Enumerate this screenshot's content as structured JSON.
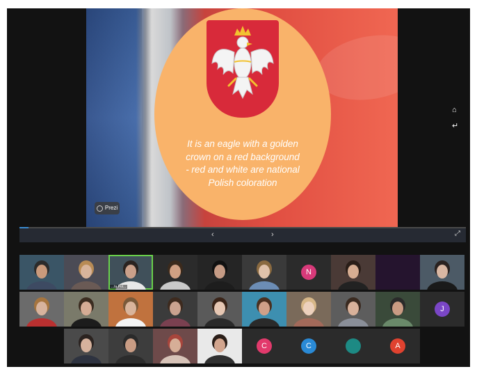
{
  "slide": {
    "text": "It is an eagle with a golden crown on a red background - red and white are national Polish coloration",
    "badge": "Prezi"
  },
  "presentation_controls": {
    "home_icon": "home-icon",
    "back_icon": "back-arrow-icon",
    "prev_label": "‹",
    "next_label": "›",
    "expand_icon": "expand-icon"
  },
  "progress": {
    "percent": 2
  },
  "gallery": {
    "tiles": [
      {
        "type": "video",
        "bg": "#3a5566",
        "skin": "#c99a7c",
        "hair": "#2b2b2b",
        "shirt": "#3d4a62"
      },
      {
        "type": "video",
        "bg": "#4b4b55",
        "skin": "#d8b49b",
        "hair": "#b88b55",
        "shirt": "#6a5a55"
      },
      {
        "type": "video",
        "bg": "#40505a",
        "skin": "#caa08a",
        "hair": "#2a2320",
        "shirt": "#e8e8e8",
        "name": "...ta Pol...",
        "active": true
      },
      {
        "type": "video",
        "bg": "#2b2b2b",
        "skin": "#d0a083",
        "hair": "#3b2a1c",
        "shirt": "#c9c9c9"
      },
      {
        "type": "video",
        "bg": "#252525",
        "skin": "#c59b85",
        "hair": "#111111",
        "shirt": "#1d1d1d"
      },
      {
        "type": "video",
        "bg": "#3a3a3a",
        "skin": "#e0c2aa",
        "hair": "#8a6a40",
        "shirt": "#6c8db5"
      },
      {
        "type": "avatar",
        "initial": "N",
        "color": "#d83a7a"
      },
      {
        "type": "video",
        "bg": "#4a3a36",
        "skin": "#d6ad92",
        "hair": "#2a1e18",
        "shirt": "#222222"
      },
      {
        "type": "empty",
        "bg": "#25142e"
      },
      {
        "type": "video",
        "bg": "#4c5a66",
        "skin": "#d9b7a3",
        "hair": "#2a2220",
        "shirt": "#1a1a1a"
      },
      {
        "type": "video",
        "bg": "#6b6b6b",
        "skin": "#d7b39d",
        "hair": "#a6753f",
        "shirt": "#b93030"
      },
      {
        "type": "video",
        "bg": "#7a7a6a",
        "skin": "#d5ac95",
        "hair": "#3b2c20",
        "shirt": "#1c1c1c"
      },
      {
        "type": "video",
        "bg": "#c0723e",
        "skin": "#d9b49b",
        "hair": "#7a5a3a",
        "shirt": "#f4f4f4"
      },
      {
        "type": "video",
        "bg": "#3b3b3b",
        "skin": "#caa28f",
        "hair": "#3d2a1e",
        "shirt": "#7a4050"
      },
      {
        "type": "video",
        "bg": "#5a5a5a",
        "skin": "#e6c7b3",
        "hair": "#3a2418",
        "shirt": "#2a2a2a"
      },
      {
        "type": "video",
        "bg": "#3d8fb0",
        "skin": "#d0a088",
        "hair": "#4a3020",
        "shirt": "#2a2a2a"
      },
      {
        "type": "video",
        "bg": "#7a6a5a",
        "skin": "#ecd0bd",
        "hair": "#d7b788",
        "shirt": "#a36a5a"
      },
      {
        "type": "video",
        "bg": "#5d5d5d",
        "skin": "#d8b19a",
        "hair": "#3a2a20",
        "shirt": "#8a8f99"
      },
      {
        "type": "video",
        "bg": "#3a4a3a",
        "skin": "#c99b83",
        "hair": "#2a2a2a",
        "shirt": "#6a8a6a"
      },
      {
        "type": "avatar",
        "initial": "J",
        "color": "#7a46c6"
      },
      {
        "type": "video",
        "bg": "#4a4a4a",
        "skin": "#d6b29d",
        "hair": "#2b2320",
        "shirt": "#2e3340"
      },
      {
        "type": "video",
        "bg": "#3d3d3d",
        "skin": "#c99c84",
        "hair": "#2a2a2a",
        "shirt": "#2c2c2c"
      },
      {
        "type": "video",
        "bg": "#6e4a4a",
        "skin": "#d6ae97",
        "hair": "#a8453c",
        "shirt": "#d7c3b8"
      },
      {
        "type": "video",
        "bg": "#e9e9e9",
        "skin": "#d2a58e",
        "hair": "#2a1e18",
        "shirt": "#303030"
      },
      {
        "type": "avatar",
        "initial": "C",
        "color": "#e23a6c"
      },
      {
        "type": "avatar",
        "initial": "C",
        "color": "#2a8ad6"
      },
      {
        "type": "avatar",
        "initial": "",
        "color": "#1d8a84"
      },
      {
        "type": "avatar",
        "initial": "A",
        "color": "#e0422f"
      }
    ]
  },
  "colors": {
    "screen_bg": "#121212",
    "tile_bg": "#2b2b2b",
    "active_speaker": "#6ad14b",
    "circle": "#f9b36a",
    "shield_red": "#d82a3a"
  }
}
